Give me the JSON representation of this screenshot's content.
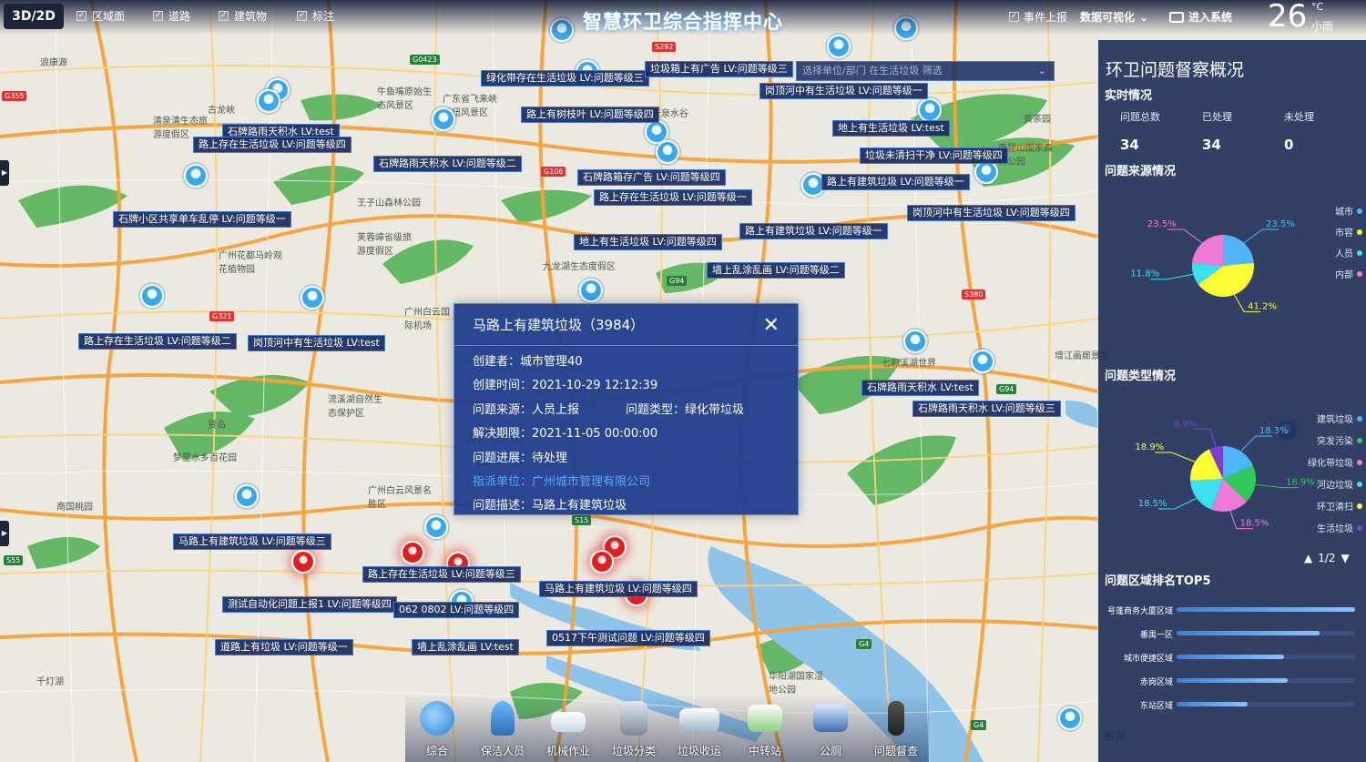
{
  "header": {
    "view_toggle": "3D/2D",
    "layers": [
      "区域面",
      "道路",
      "建筑物",
      "标注"
    ],
    "title": "智慧环卫综合指挥中心",
    "event_report": "事件上报",
    "data_visual": "数据可视化",
    "enter_system": "进入系统",
    "weather": {
      "temp": "26",
      "unit": "°C",
      "desc": "小雨"
    }
  },
  "filter": {
    "placeholder": "选择单位/部门  在生活垃圾  筛选"
  },
  "map_tags": [
    "绿化带存在生活垃圾 LV:问题等级三",
    "垃圾箱上有广告 LV:问题等级三",
    "岗顶河中有生活垃圾 LV:问题等级一",
    "路上有树枝叶 LV:问题等级四",
    "石牌路雨天积水 LV:test",
    "路上存在生活垃圾 LV:问题等级四",
    "地上有生活垃圾 LV:test",
    "石牌路雨天积水 LV:问题等级二",
    "垃圾未清扫干净 LV:问题等级四",
    "石牌路箱存广告 LV:问题等级四",
    "路上有建筑垃圾 LV:问题等级一",
    "路上存在生活垃圾 LV:问题等级一",
    "岗顶河中有生活垃圾 LV:问题等级四",
    "石牌小区共享单车乱停 LV:问题等级一",
    "路上有建筑垃圾 LV:问题等级一",
    "地上有生活垃圾 LV:问题等级四",
    "墙上乱涂乱画 LV:问题等级二",
    "路上存在生活垃圾 LV:问题等级二",
    "岗顶河中有生活垃圾 LV:test",
    "石牌路雨天积水 LV:test",
    "石牌路雨天积水 LV:问题等级三",
    "马路上有建筑垃圾 LV:问题等级三",
    "路上存在生活垃圾 LV:问题等级三",
    "测试自动化问题上报1 LV:问题等级四",
    "马路上有建筑垃圾 LV:问题等级四",
    "062 0802 LV:问题等级四",
    "道路上有垃圾 LV:问题等级一",
    "墙上乱涂乱画 LV:test",
    "0517下午测试问题 LV:问题等级四"
  ],
  "places": [
    "浪康源",
    "古龙峡",
    "清泉清生态旅游度假区",
    "牛鱼嘴原始生态风景区",
    "广东省飞来峡枢纽风景区",
    "天泉水谷",
    "石牌路雨天积水",
    "王子山森林公园",
    "芙蓉嶂省级旅游度假区",
    "广州花都马岭观花植物园",
    "九龙湖生态度假区",
    "流溪湖自然生态保护区",
    "梦里水乡百花园",
    "广州白云风景名胜区",
    "南国桃园",
    "七彩溪湖世界",
    "华阳湖国家湿地公园",
    "黄茶园",
    "南昆山国家森林公园",
    "千灯湖",
    "东莞",
    "广州白云国际机场",
    "贤岛",
    "增江画廊景区"
  ],
  "popup": {
    "title": "马路上有建筑垃圾（3984）",
    "creator_label": "创建者：",
    "creator": "城市管理40",
    "time_label": "创建时间：",
    "time": "2021-10-29 12:12:39",
    "source_label": "问题来源：",
    "source": "人员上报",
    "type_label": "问题类型：",
    "type": "绿化带垃圾",
    "deadline_label": "解决期限：",
    "deadline": "2021-11-05 00:00:00",
    "progress_label": "问题进展：",
    "progress": "待处理",
    "unit_label": "指派单位：",
    "unit": "广州城市管理有限公司",
    "desc_label": "问题描述：",
    "desc": "马路上有建筑垃圾"
  },
  "panel": {
    "title": "环卫问题督察概况",
    "realtime": "实时情况",
    "stats": [
      {
        "label": "问题总数",
        "value": "34"
      },
      {
        "label": "已处理",
        "value": "34"
      },
      {
        "label": "未处理",
        "value": "0"
      }
    ],
    "source_title": "问题来源情况",
    "type_title": "问题类型情况",
    "ranking_title": "问题区域排名TOP5",
    "pager": "1/2"
  },
  "chart_data": [
    {
      "type": "pie",
      "title": "问题来源情况",
      "categories": [
        "城市",
        "市容",
        "人员",
        "内部"
      ],
      "values": [
        23.5,
        41.2,
        11.8,
        23.5
      ],
      "colors": [
        "#4fb6f5",
        "#ffff33",
        "#38e0f0",
        "#f07ad8"
      ]
    },
    {
      "type": "pie",
      "title": "问题类型情况",
      "categories": [
        "建筑垃圾",
        "突发污染",
        "绿化带垃圾",
        "河边垃圾",
        "环卫清扫",
        "生活垃圾"
      ],
      "values": [
        18.3,
        18.9,
        18.5,
        18.5,
        18.9,
        6.9
      ],
      "colors": [
        "#4fb6f5",
        "#2ec95a",
        "#f07ad8",
        "#38e0f0",
        "#ffff33",
        "#7b3fd8"
      ]
    },
    {
      "type": "bar",
      "title": "问题区域排名TOP5",
      "categories": [
        "号蓬商务大厦区域",
        "番禺一区",
        "城市便捷区域",
        "赤岗区域",
        "东站区域"
      ],
      "values": [
        100,
        80,
        60,
        62,
        40
      ]
    }
  ],
  "bottom_nav": [
    "综合",
    "保洁人员",
    "机械作业",
    "垃圾分类",
    "垃圾收运",
    "中转站",
    "公厕",
    "问题督查"
  ]
}
